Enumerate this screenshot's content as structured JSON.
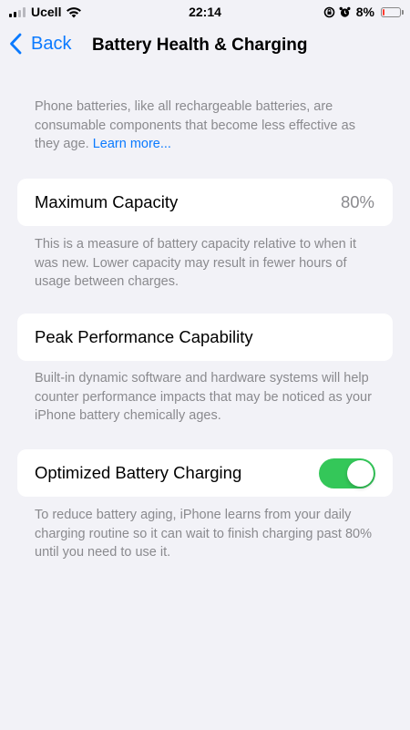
{
  "status_bar": {
    "carrier": "Ucell",
    "time": "22:14",
    "battery_percent": "8%",
    "battery_color": "#ff3b30",
    "icons": [
      "signal-icon",
      "wifi-icon",
      "orientation-lock-icon",
      "alarm-icon",
      "battery-icon"
    ]
  },
  "nav": {
    "back_label": "Back",
    "title": "Battery Health & Charging",
    "accent_color": "#0a7aff"
  },
  "intro": {
    "text": "Phone batteries, like all rechargeable batteries, are consumable components that become less effective as they age.",
    "link_label": "Learn more..."
  },
  "maximum_capacity": {
    "label": "Maximum Capacity",
    "value": "80%",
    "description": "This is a measure of battery capacity relative to when it was new. Lower capacity may result in fewer hours of usage between charges."
  },
  "peak_performance": {
    "label": "Peak Performance Capability",
    "description": "Built-in dynamic software and hardware systems will help counter performance impacts that may be noticed as your iPhone battery chemically ages."
  },
  "optimized_charging": {
    "label": "Optimized Battery Charging",
    "enabled": true,
    "toggle_color": "#34c759",
    "description": "To reduce battery aging, iPhone learns from your daily charging routine so it can wait to finish charging past 80% until you need to use it."
  }
}
